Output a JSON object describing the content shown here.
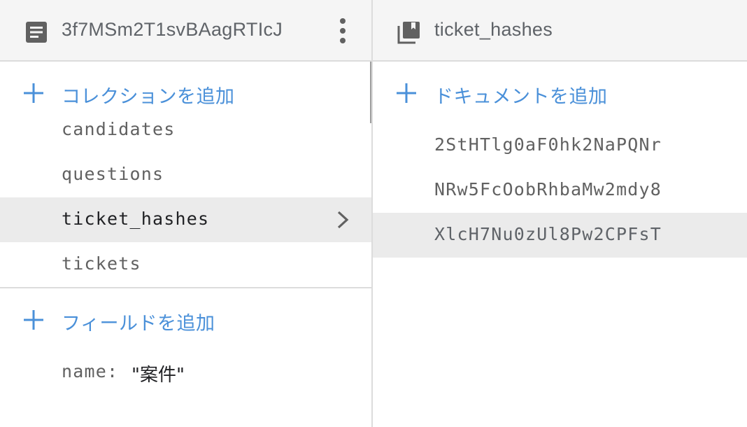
{
  "document_panel": {
    "title": "3f7MSm2T1svBAagRTIcJ",
    "title_icon": "document-icon",
    "menu_icon": "more-vert-icon",
    "add_collection_label": "コレクションを追加",
    "collections": [
      {
        "label": "candidates",
        "selected": false
      },
      {
        "label": "questions",
        "selected": false
      },
      {
        "label": "ticket_hashes",
        "selected": true
      },
      {
        "label": "tickets",
        "selected": false
      }
    ],
    "add_field_label": "フィールドを追加",
    "fields": [
      {
        "key": "name:",
        "value": "\"案件\""
      }
    ]
  },
  "collection_panel": {
    "title": "ticket_hashes",
    "title_icon": "collection-icon",
    "add_document_label": "ドキュメントを追加",
    "documents": [
      {
        "label": "2StHTlg0aF0hk2NaPQNr",
        "selected": false
      },
      {
        "label": "NRw5FcOobRhbaMw2mdy8",
        "selected": false
      },
      {
        "label": "XlcH7Nu0zUl8Pw2CPFsT",
        "selected": true
      }
    ]
  },
  "colors": {
    "accent": "#4a90d9",
    "header_bg": "#f5f5f5",
    "selected_bg": "#ebebeb",
    "divider": "#dcdcdc",
    "icon": "#616161"
  }
}
